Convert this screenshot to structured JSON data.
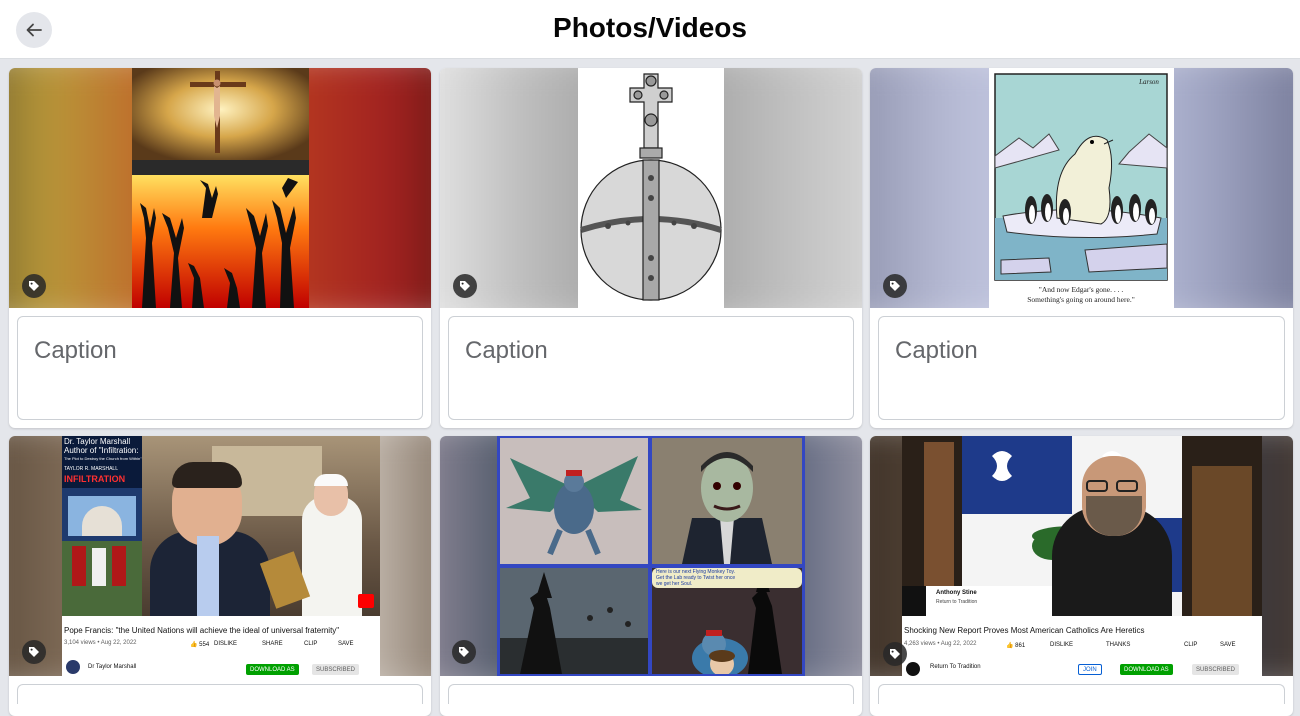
{
  "header": {
    "title": "Photos/Videos",
    "back_icon": "arrow-left-icon"
  },
  "colors": {
    "page_bg": "#e4e6eb",
    "card_bg": "#ffffff",
    "caption_border": "#ccd0d5",
    "caption_placeholder": "#65676b",
    "tag_bg": "#282828",
    "youtube_red": "#ff0000",
    "download_green": "#00a000"
  },
  "photos": [
    {
      "id": "photo-1",
      "caption_placeholder": "Caption",
      "tag_icon": "tag-icon",
      "description": "Crucifixion above people raising arms in flames"
    },
    {
      "id": "photo-2",
      "caption_placeholder": "Caption",
      "tag_icon": "tag-icon",
      "description": "Engraving of a cross-topped orb"
    },
    {
      "id": "photo-3",
      "caption_placeholder": "Caption",
      "tag_icon": "tag-icon",
      "cartoon_signature": "Larson",
      "cartoon_caption_line1": "\"And now Edgar's gone. . . .",
      "cartoon_caption_line2": "Something's going on around here.\""
    },
    {
      "id": "photo-4",
      "tag_icon": "tag-icon",
      "overlay_line1": "Dr. Taylor Marshall",
      "overlay_line2": "Author of \"Infiltration:",
      "overlay_line3": "The Plot to Destroy the Church from Within\"",
      "book_author": "TAYLOR R. MARSHALL",
      "book_title": "INFILTRATION",
      "video_title": "Pope Francis: \"the United Nations will achieve the ideal of universal fraternity\"",
      "video_meta": "3,104 views • Aug 22, 2022",
      "likes": "554",
      "dislike": "DISLIKE",
      "share": "SHARE",
      "clip": "CLIP",
      "save": "SAVE",
      "channel": "Dr Taylor Marshall",
      "download_label": "DOWNLOAD AS",
      "subscribed_label": "SUBSCRIBED"
    },
    {
      "id": "photo-5",
      "tag_icon": "tag-icon",
      "speech_text_1": "Here is our next Flying Monkey Toy.",
      "speech_text_2": "Get the Lab ready to Twist her once",
      "speech_text_3": "we get her Soul."
    },
    {
      "id": "photo-6",
      "tag_icon": "tag-icon",
      "lower_third_name": "Anthony Stine",
      "lower_third_sub": "Return to Tradition",
      "video_title": "Shocking New Report Proves Most American Catholics Are Heretics",
      "video_meta": "4,263 views • Aug 22, 2022",
      "likes": "861",
      "dislike": "DISLIKE",
      "thanks": "THANKS",
      "clip": "CLIP",
      "save": "SAVE",
      "channel": "Return To Tradition",
      "join_label": "JOIN",
      "download_label": "DOWNLOAD AS",
      "subscribed_label": "SUBSCRIBED"
    }
  ]
}
